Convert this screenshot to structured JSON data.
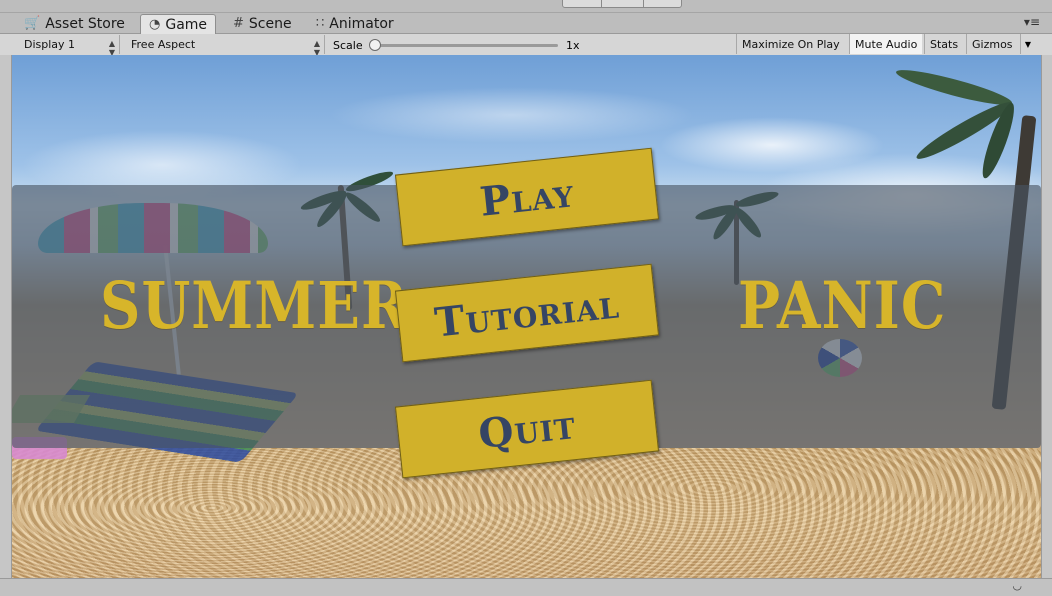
{
  "tabs": [
    {
      "label": "Asset Store",
      "icon": "asset-store-icon"
    },
    {
      "label": "Game",
      "icon": "game-icon",
      "active": true
    },
    {
      "label": "Scene",
      "icon": "scene-grid-icon"
    },
    {
      "label": "Animator",
      "icon": "animator-icon"
    }
  ],
  "toolbar": {
    "display": "Display 1",
    "aspect": "Free Aspect",
    "scale_label": "Scale",
    "scale_value": "1x",
    "scale_fraction": 0.0,
    "maximize": "Maximize On Play",
    "mute": "Mute Audio",
    "stats": "Stats",
    "gizmos": "Gizmos"
  },
  "game": {
    "title_left": "SUMMER",
    "title_right": "PANIC",
    "buttons": [
      "Play",
      "Tutorial",
      "Quit"
    ]
  },
  "colors": {
    "button_fill": "#d1b12a",
    "button_text": "#354564",
    "title_text": "#d7b52a",
    "overlay": "#485462"
  }
}
